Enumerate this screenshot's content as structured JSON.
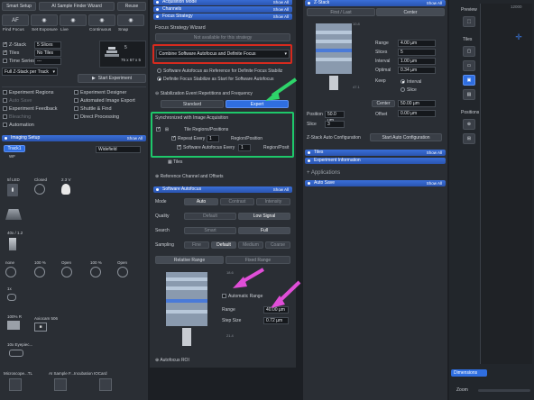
{
  "left": {
    "top_buttons": [
      "Smart Setup",
      "AI Sample Finder Wizard",
      "Reuse"
    ],
    "tool_buttons": [
      {
        "icon": "AF",
        "label": "Find Focus"
      },
      {
        "icon": "",
        "label": "Set Exposure"
      },
      {
        "icon": "",
        "label": "Live"
      },
      {
        "icon": "",
        "label": "Continuous"
      },
      {
        "icon": "",
        "label": "Snap"
      }
    ],
    "exp_options": [
      {
        "label": "Z-Stack",
        "value": "5 Slices",
        "checked": true
      },
      {
        "label": "Tiles",
        "value": "No Tiles",
        "checked": true
      },
      {
        "label": "Time Series",
        "value": "---",
        "checked": false
      }
    ],
    "track_select": "Full Z-Stack per Track",
    "info_counts": [
      "5",
      "75 x 67 x 5"
    ],
    "start_button": "Start Experiment",
    "checkbox_col1": [
      "Experiment Regions",
      "Auto Save",
      "Experiment Feedback",
      "Bleaching",
      "Automation"
    ],
    "checkbox_col2": [
      "Experiment Designer",
      "Automated Image Export",
      "Shuttle & Find",
      "Direct Processing"
    ],
    "imaging_setup": {
      "header": "Imaging Setup",
      "show_all": "Show All",
      "track": "Track1",
      "channel": "WF",
      "widefield": "Widefield"
    },
    "light_path": {
      "row1": [
        "5f LED",
        "Closed",
        "2.3 V"
      ],
      "objective": "40x / 1.2",
      "row2": [
        "none",
        "100 %",
        "Open",
        "100 %",
        "Open"
      ],
      "mag": "1x",
      "row3": [
        "100% R",
        "Axiocam 506"
      ],
      "extra": "10x Eyepiec..."
    },
    "bottom_tabs": [
      "Microscope...TL",
      "AI Sample F...Incubation",
      "IOCard"
    ]
  },
  "middle": {
    "headers_top": [
      "Acquisition Mode",
      "Channels",
      "Focus Strategy"
    ],
    "show_all": "Show All",
    "wizard_label": "Focus Strategy Wizard",
    "wizard_button": "Not available for this strategy",
    "strategy_select": "Combine Software Autofocus and Definite Focus",
    "radio_options": [
      "Software Autofocus as Reference for Definite Focus Stabiliz",
      "Definite Focus Stabilize as Start for Software Autofocus"
    ],
    "stab_label": "Stabilization Event Repetitions and Frequency",
    "stab_buttons": [
      "Standard",
      "Expert"
    ],
    "sync_label": "Synchronized with Image Acquisition",
    "sync_items": {
      "tile": "Tile Regions/Positions",
      "repeat": "Repeat Every",
      "repeat_val": "1",
      "repeat_unit": "Region/Position",
      "sa": "Software Autofocus Every",
      "sa_val": "1",
      "sa_unit": "Region/Posit"
    },
    "tiles": "Tiles",
    "ref_channel": "Reference Channel and Offsets",
    "sw_af": {
      "header": "Software Autofocus",
      "mode_label": "Mode",
      "mode_opts": [
        "Auto",
        "Contrast",
        "Intensity"
      ],
      "quality_label": "Quality",
      "quality_opts": [
        "Default",
        "Low Signal"
      ],
      "search_label": "Search",
      "search_opts": [
        "Smart",
        "Full"
      ],
      "sampling_label": "Sampling",
      "sampling_opts": [
        "Fine",
        "Default",
        "Medium",
        "Coarse"
      ],
      "range_tabs": [
        "Relative Range",
        "Fixed Range"
      ],
      "scale_top": "18.6",
      "scale_bot": "21.4",
      "auto_range": "Automatic Range",
      "range_label": "Range",
      "range_val": "40.00 µm",
      "step_label": "Step Size",
      "step_val": "0.72 µm",
      "roi": "Autofocus ROI"
    }
  },
  "right": {
    "zstack_header": "Z-Stack",
    "tabs": [
      "First / Last",
      "Center"
    ],
    "scale": [
      "10.8",
      "47.1"
    ],
    "fields": [
      {
        "label": "Range",
        "value": "4.00 µm"
      },
      {
        "label": "Slices",
        "value": "5"
      },
      {
        "label": "Interval",
        "value": "1.00 µm"
      },
      {
        "label": "Optimal",
        "value": "0.34 µm"
      }
    ],
    "keep_label": "Keep",
    "keep_opts": [
      "Interval",
      "Slice"
    ],
    "center_label": "Center",
    "center_val": "50.00 µm",
    "offset_label": "Offset",
    "offset_val": "0.00 µm",
    "position_label": "Position",
    "position_val": "50.0 µm",
    "slice_label": "Slice",
    "slice_val": "3",
    "zaf_label": "Z-Stack Auto Configuration",
    "zaf_button": "Start Auto Configuration",
    "bottom_headers": [
      "Tiles",
      "Experiment Information"
    ],
    "applications": "Applications",
    "autosave": "Auto Save",
    "show_all": "Show All"
  },
  "far": {
    "preview": "Preview",
    "tiles": "Tiles",
    "positions": "Positions",
    "scale_num": "12000",
    "dimensions": "Dimensions",
    "zoom": "Zoom"
  },
  "colors": {
    "accent": "#2f6ee0",
    "red_box": "#d62a1e",
    "green_box": "#1ec86a",
    "green_arrow": "#2ed46a",
    "pink_arrow": "#e04ed8"
  }
}
